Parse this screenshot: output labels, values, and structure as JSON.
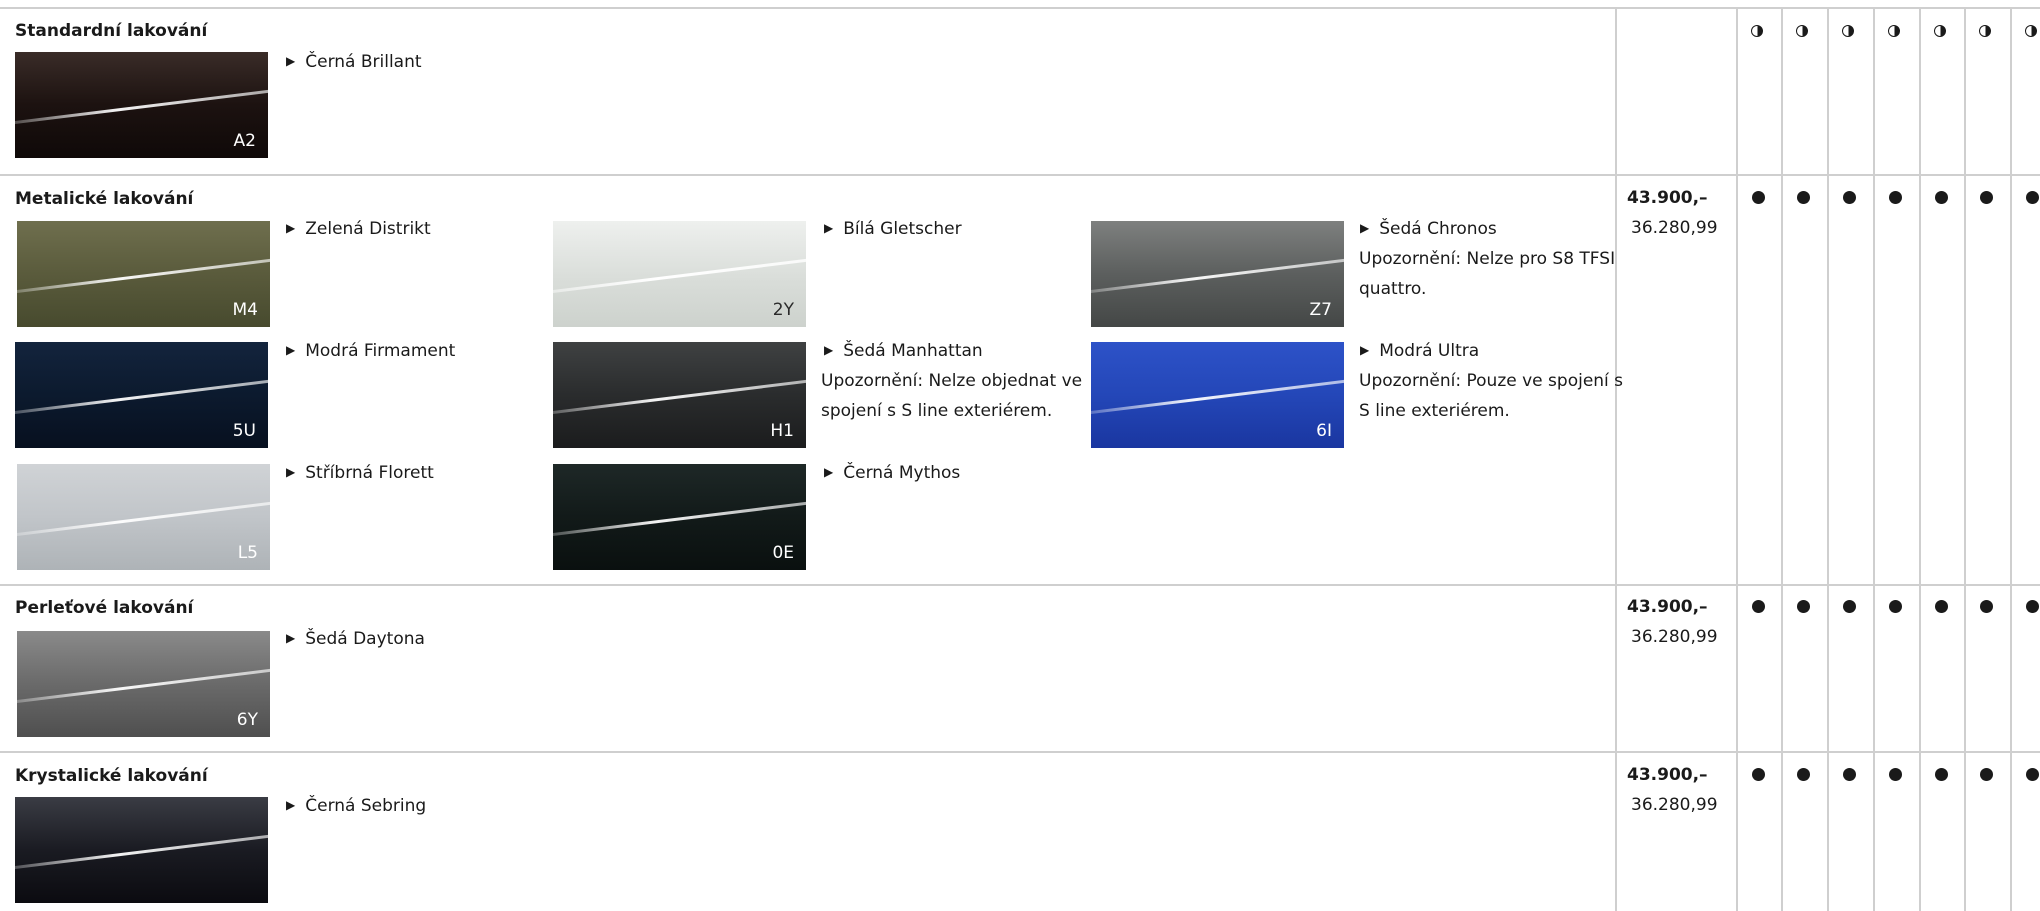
{
  "sections": [
    {
      "title": "Standardní lakování",
      "colors": [
        {
          "name": "Černá Brillant",
          "code": "A2",
          "note": "",
          "gradient": "linear-gradient(180deg,#3a2c28 0%,#1c1210 50%,#0f0908 100%)",
          "light": false
        }
      ],
      "price_main": "",
      "price_sub": "",
      "mark_type": "open"
    },
    {
      "title": "Metalické lakování",
      "colors": [
        {
          "name": "Zelená Distrikt",
          "code": "M4",
          "note": "",
          "gradient": "linear-gradient(180deg,#6f6f4e 0%,#5a5b3c 50%,#474a2e 100%)",
          "light": false
        },
        {
          "name": "Bílá Gletscher",
          "code": "2Y",
          "note": "",
          "gradient": "linear-gradient(180deg,#eef0ee 0%,#d9ddd9 55%,#cdd2cd 100%)",
          "light": true
        },
        {
          "name": "Šedá Chronos",
          "code": "Z7",
          "note": "Upozornění: Nelze pro S8 TFSI quattro.",
          "gradient": "linear-gradient(180deg,#7e807f 0%,#5c5f5e 50%,#444746 100%)",
          "light": false
        },
        {
          "name": "Modrá Firmament",
          "code": "5U",
          "note": "",
          "gradient": "linear-gradient(180deg,#13243d 0%,#0c1a2e 50%,#07101f 100%)",
          "light": false
        },
        {
          "name": "Šedá Manhattan",
          "code": "H1",
          "note": "Upozornění: Nelze objednat ve spojení s S line exteriérem.",
          "gradient": "linear-gradient(180deg,#3f4142 0%,#2a2c2d 50%,#1b1c1d 100%)",
          "light": false
        },
        {
          "name": "Modrá Ultra",
          "code": "6I",
          "note": "Upozornění: Pouze ve spojení s S line exteriérem.",
          "gradient": "linear-gradient(180deg,#2d52c8 0%,#2447b8 50%,#1a36a0 100%)",
          "light": false
        },
        {
          "name": "Stříbrná Florett",
          "code": "L5",
          "note": "",
          "gradient": "linear-gradient(180deg,#d0d3d6 0%,#c1c5c9 50%,#aeb3b7 100%)",
          "light": false
        },
        {
          "name": "Černá Mythos",
          "code": "0E",
          "note": "",
          "gradient": "linear-gradient(180deg,#1e2827 0%,#121a19 50%,#0a100f 100%)",
          "light": false
        }
      ],
      "price_main": "43.900,–",
      "price_sub": "36.280,99",
      "mark_type": "full"
    },
    {
      "title": "Perleťové lakování",
      "colors": [
        {
          "name": "Šedá Daytona",
          "code": "6Y",
          "note": "",
          "gradient": "linear-gradient(180deg,#8a8a8a 0%,#6a6a6a 50%,#4f4f4f 100%)",
          "light": false
        }
      ],
      "price_main": "43.900,–",
      "price_sub": "36.280,99",
      "mark_type": "full"
    },
    {
      "title": "Krystalické lakování",
      "colors": [
        {
          "name": "Černá Sebring",
          "code": "",
          "note": "",
          "gradient": "linear-gradient(180deg,#3a3c44 0%,#1a1b22 50%,#0b0b10 100%)",
          "light": false
        }
      ],
      "price_main": "43.900,–",
      "price_sub": "36.280,99",
      "mark_type": "full"
    }
  ],
  "availability_columns": 7
}
